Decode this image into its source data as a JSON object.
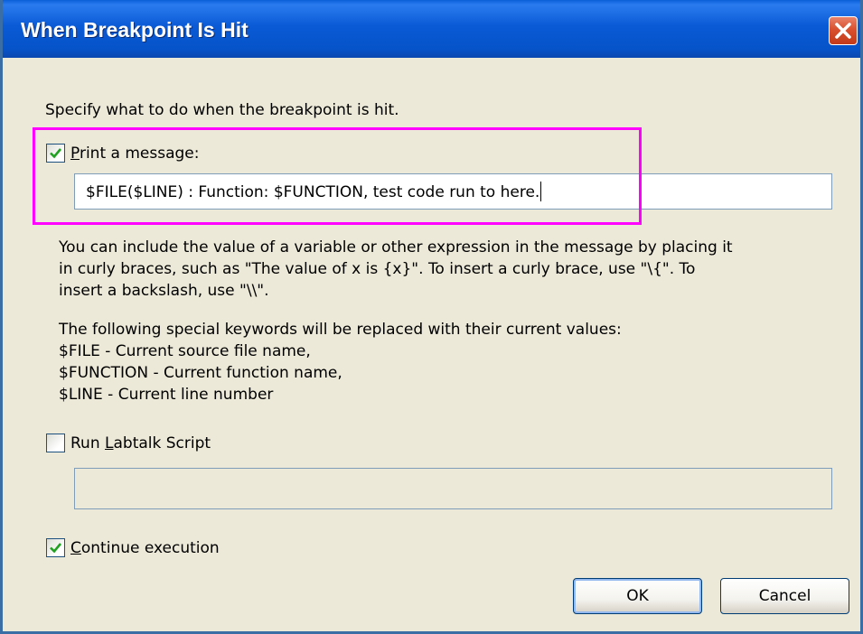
{
  "window": {
    "title": "When Breakpoint Is Hit"
  },
  "dialog": {
    "intro": "Specify what to do when the breakpoint is hit.",
    "print_message": {
      "checked": true,
      "label_mnemonic": "P",
      "label_rest": "rint a message:",
      "value": "$FILE($LINE) : Function: $FUNCTION, test code run to here."
    },
    "help_lines": [
      "You can include the value of a variable or other expression in the message by placing it",
      "in curly braces, such as \"The value of x is {x}\". To insert a curly brace, use \"\\{\". To",
      "insert a backslash, use \"\\\\\"."
    ],
    "keyword_lines": [
      "The following special keywords will be replaced with their current values:",
      "$FILE - Current source file name,",
      "$FUNCTION - Current function name,",
      "$LINE - Current line number"
    ],
    "run_script": {
      "checked": false,
      "label_prefix": "Run ",
      "label_mnemonic": "L",
      "label_rest": "abtalk Script",
      "value": ""
    },
    "continue_execution": {
      "checked": true,
      "label_mnemonic": "C",
      "label_rest": "ontinue execution"
    },
    "buttons": {
      "ok": "OK",
      "cancel": "Cancel"
    }
  },
  "colors": {
    "highlight": "#ff00ff",
    "titlebar": "#0a5ad6",
    "dialog_bg": "#ece9d8",
    "checkmark": "#21a121"
  }
}
